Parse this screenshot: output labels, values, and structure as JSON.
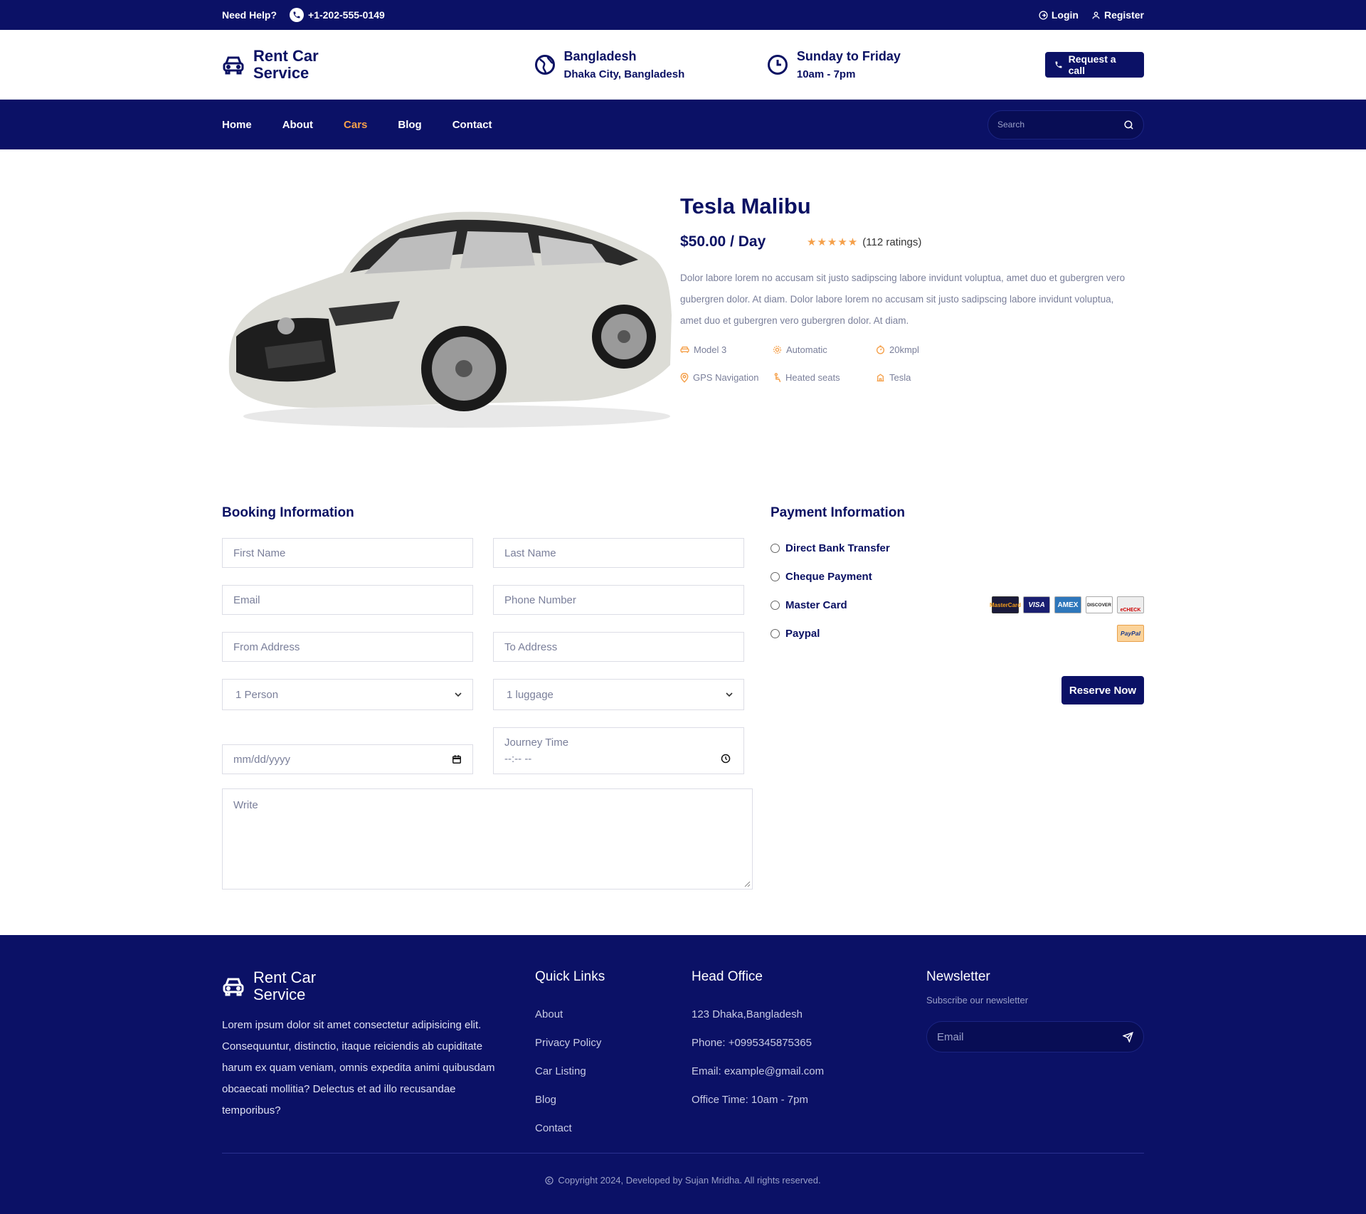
{
  "topbar": {
    "need_help": "Need Help?",
    "phone": "+1-202-555-0149",
    "login": "Login",
    "register": "Register"
  },
  "header": {
    "logo_line1": "Rent Car",
    "logo_line2": "Service",
    "location_title": "Bangladesh",
    "location_sub": "Dhaka City, Bangladesh",
    "hours_title": "Sunday to Friday",
    "hours_sub": "10am - 7pm",
    "call_button": "Request a call"
  },
  "nav": {
    "items": [
      "Home",
      "About",
      "Cars",
      "Blog",
      "Contact"
    ],
    "active": "Cars",
    "search_placeholder": "Search"
  },
  "product": {
    "name": "Tesla Malibu",
    "price": "$50.00 / Day",
    "rating": 5,
    "stars": "★★★★★",
    "ratings_text": "(112 ratings)",
    "description": "Dolor labore lorem no accusam sit justo sadipscing labore invidunt voluptua, amet duo et gubergren vero gubergren dolor. At diam. Dolor labore lorem no accusam sit justo sadipscing labore invidunt voluptua, amet duo et gubergren vero gubergren dolor. At diam.",
    "features": [
      {
        "icon": "car-icon",
        "label": "Model 3"
      },
      {
        "icon": "gear-icon",
        "label": "Automatic"
      },
      {
        "icon": "gauge-icon",
        "label": "20kmpl"
      },
      {
        "icon": "location-pin-icon",
        "label": "GPS Navigation"
      },
      {
        "icon": "seat-icon",
        "label": "Heated seats"
      },
      {
        "icon": "building-icon",
        "label": "Tesla"
      }
    ]
  },
  "booking": {
    "title": "Booking Information",
    "first_name": "First Name",
    "last_name": "Last Name",
    "email": "Email",
    "phone": "Phone Number",
    "from_address": "From Address",
    "to_address": "To Address",
    "persons": "1 Person",
    "luggage": "1 luggage",
    "date": "mm/dd/yyyy",
    "journey_time_label": "Journey Time",
    "journey_time_value": "--:-- --",
    "write": "Write"
  },
  "payment": {
    "title": "Payment Information",
    "options": [
      "Direct Bank Transfer",
      "Cheque Payment",
      "Master Card",
      "Paypal"
    ],
    "cards": [
      "MasterCard",
      "VISA",
      "AMEX",
      "DISCOVER",
      "eCHECK"
    ],
    "paypal": "PayPal",
    "reserve_button": "Reserve Now"
  },
  "footer": {
    "logo_line1": "Rent Car",
    "logo_line2": "Service",
    "about": "Lorem ipsum dolor sit amet consectetur adipisicing elit. Consequuntur, distinctio, itaque reiciendis ab cupiditate harum ex quam veniam, omnis expedita animi quibusdam obcaecati mollitia? Delectus et ad illo recusandae temporibus?",
    "quick_links_title": "Quick Links",
    "quick_links": [
      "About",
      "Privacy Policy",
      "Car Listing",
      "Blog",
      "Contact"
    ],
    "head_office_title": "Head Office",
    "head_office": [
      "123 Dhaka,Bangladesh",
      "Phone: +0995345875365",
      "Email: example@gmail.com",
      "Office Time: 10am - 7pm"
    ],
    "newsletter_title": "Newsletter",
    "newsletter_sub": "Subscribe our newsletter",
    "newsletter_placeholder": "Email",
    "copyright": "Copyright 2024, Developed by Sujan Mridha. All rights reserved."
  },
  "colors": {
    "primary": "#0b1166",
    "accent": "#f5a04a"
  }
}
